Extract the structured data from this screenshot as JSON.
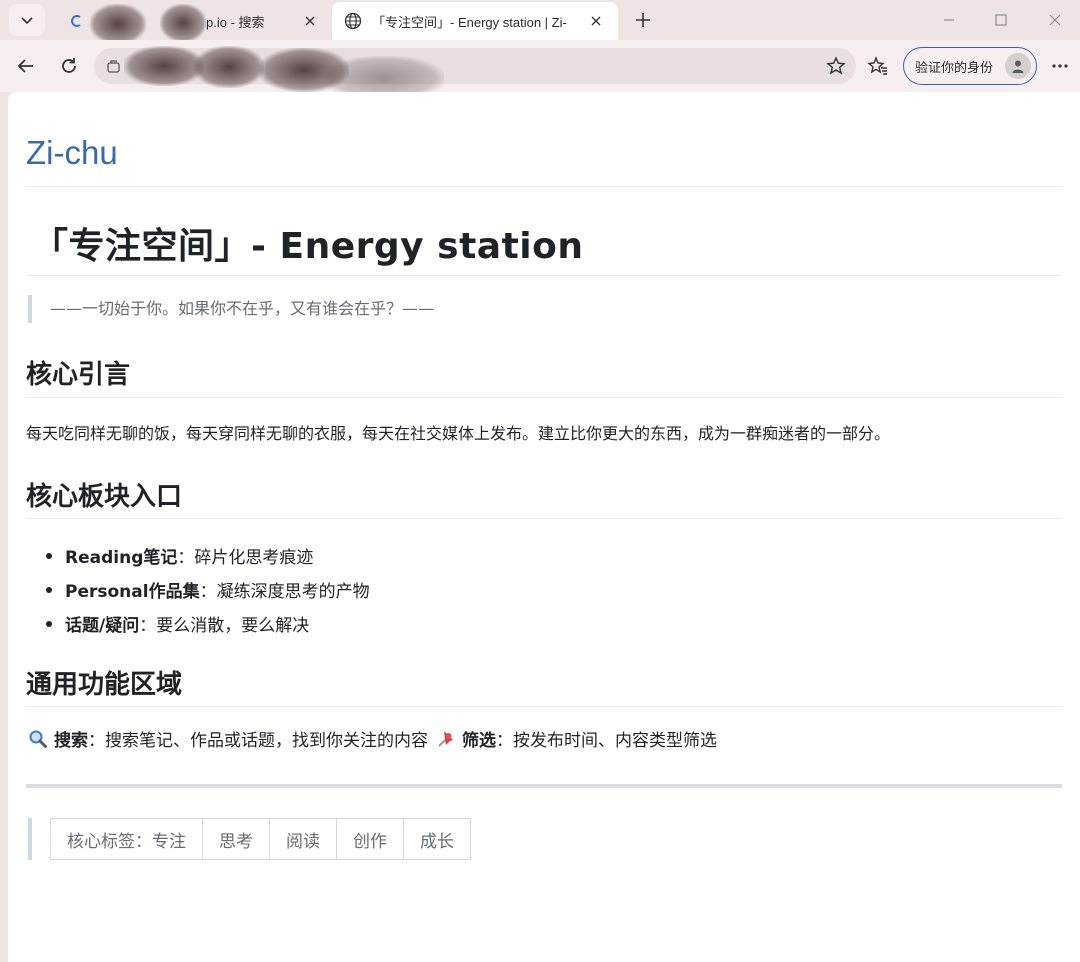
{
  "browser": {
    "tabs": [
      {
        "title": "p.io - 搜索",
        "active": false
      },
      {
        "title": "「专注空间」- Energy station | Zi-",
        "active": true
      }
    ],
    "verify_button": "验证你的身份",
    "address": ""
  },
  "page": {
    "site_title": "Zi-chu",
    "title": "「专注空间」- Energy station",
    "quote": "——一切始于你。如果你不在乎，又有谁会在乎？——",
    "section_quote_heading": "核心引言",
    "core_quote": "每天吃同样无聊的饭，每天穿同样无聊的衣服，每天在社交媒体上发布。建立比你更大的东西，成为一群痴迷者的一部分。",
    "section_modules_heading": "核心板块入口",
    "modules": [
      {
        "name": "Reading笔记",
        "desc": "：碎片化思考痕迹"
      },
      {
        "name": "Personal作品集",
        "desc": "：凝练深度思考的产物"
      },
      {
        "name": "话题/疑问",
        "desc": "：要么消散，要么解决"
      }
    ],
    "section_functions_heading": "通用功能区域",
    "functions": {
      "search_label": "搜索",
      "search_desc": "：搜索笔记、作品或话题，找到你关注的内容",
      "filter_label": "筛选",
      "filter_desc": "：按发布时间、内容类型筛选"
    },
    "tags": [
      "核心标签：专注",
      "思考",
      "阅读",
      "创作",
      "成长"
    ]
  },
  "colors": {
    "link": "#3b6aa8",
    "chrome_bg": "#efe4e4",
    "accent_border": "#3b63b8"
  }
}
